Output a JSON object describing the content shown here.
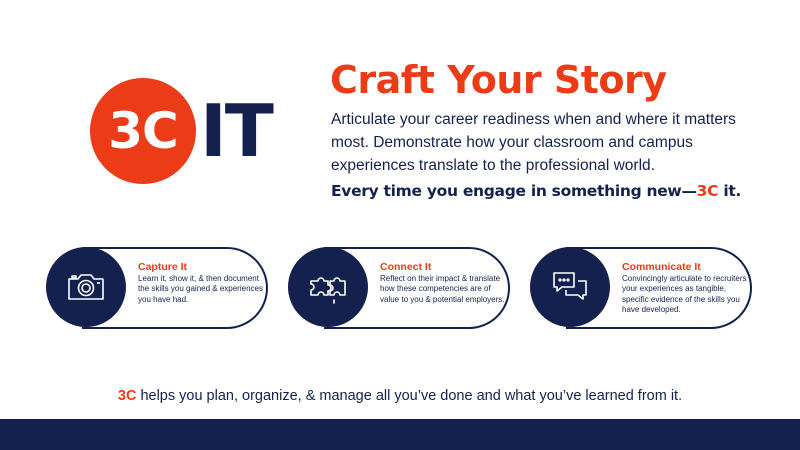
{
  "logo": {
    "circle_text": "3C",
    "side_text": "IT"
  },
  "headline": "Craft Your Story",
  "intro": "Articulate your career readiness when and where it matters most. Demonstrate how your classroom and campus experiences translate to the professional world.",
  "tagline": {
    "prefix": "Every time you engage in something new—",
    "accent": "3C",
    "suffix": " it."
  },
  "cards": [
    {
      "icon": "camera-icon",
      "title": "Capture It",
      "desc": "Learn it, show it, & then document the skills you gained & experiences you have had."
    },
    {
      "icon": "puzzle-icon",
      "title": "Connect It",
      "desc": "Reflect on their impact & translate how these competencies are of value to you & potential employers."
    },
    {
      "icon": "chat-bubbles-icon",
      "title": "Communicate It",
      "desc": "Convincingly articulate to recruiters your experiences as tangible, specific evidence of the skills you have developed."
    }
  ],
  "footer": {
    "accent": "3C",
    "text": " helps you plan, organize, & manage all you’ve done and what you’ve learned from it."
  },
  "colors": {
    "navy": "#14214f",
    "orange": "#ec3b17"
  }
}
